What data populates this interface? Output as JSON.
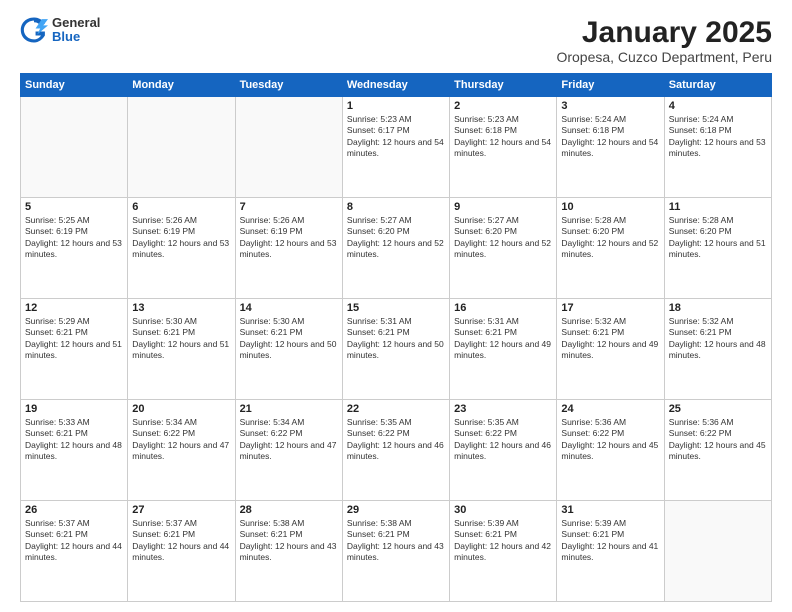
{
  "logo": {
    "general": "General",
    "blue": "Blue"
  },
  "title": "January 2025",
  "subtitle": "Oropesa, Cuzco Department, Peru",
  "days_of_week": [
    "Sunday",
    "Monday",
    "Tuesday",
    "Wednesday",
    "Thursday",
    "Friday",
    "Saturday"
  ],
  "cells": [
    {
      "day": "",
      "sunrise": "",
      "sunset": "",
      "daylight": ""
    },
    {
      "day": "",
      "sunrise": "",
      "sunset": "",
      "daylight": ""
    },
    {
      "day": "",
      "sunrise": "",
      "sunset": "",
      "daylight": ""
    },
    {
      "day": "1",
      "sunrise": "Sunrise: 5:23 AM",
      "sunset": "Sunset: 6:17 PM",
      "daylight": "Daylight: 12 hours and 54 minutes."
    },
    {
      "day": "2",
      "sunrise": "Sunrise: 5:23 AM",
      "sunset": "Sunset: 6:18 PM",
      "daylight": "Daylight: 12 hours and 54 minutes."
    },
    {
      "day": "3",
      "sunrise": "Sunrise: 5:24 AM",
      "sunset": "Sunset: 6:18 PM",
      "daylight": "Daylight: 12 hours and 54 minutes."
    },
    {
      "day": "4",
      "sunrise": "Sunrise: 5:24 AM",
      "sunset": "Sunset: 6:18 PM",
      "daylight": "Daylight: 12 hours and 53 minutes."
    },
    {
      "day": "5",
      "sunrise": "Sunrise: 5:25 AM",
      "sunset": "Sunset: 6:19 PM",
      "daylight": "Daylight: 12 hours and 53 minutes."
    },
    {
      "day": "6",
      "sunrise": "Sunrise: 5:26 AM",
      "sunset": "Sunset: 6:19 PM",
      "daylight": "Daylight: 12 hours and 53 minutes."
    },
    {
      "day": "7",
      "sunrise": "Sunrise: 5:26 AM",
      "sunset": "Sunset: 6:19 PM",
      "daylight": "Daylight: 12 hours and 53 minutes."
    },
    {
      "day": "8",
      "sunrise": "Sunrise: 5:27 AM",
      "sunset": "Sunset: 6:20 PM",
      "daylight": "Daylight: 12 hours and 52 minutes."
    },
    {
      "day": "9",
      "sunrise": "Sunrise: 5:27 AM",
      "sunset": "Sunset: 6:20 PM",
      "daylight": "Daylight: 12 hours and 52 minutes."
    },
    {
      "day": "10",
      "sunrise": "Sunrise: 5:28 AM",
      "sunset": "Sunset: 6:20 PM",
      "daylight": "Daylight: 12 hours and 52 minutes."
    },
    {
      "day": "11",
      "sunrise": "Sunrise: 5:28 AM",
      "sunset": "Sunset: 6:20 PM",
      "daylight": "Daylight: 12 hours and 51 minutes."
    },
    {
      "day": "12",
      "sunrise": "Sunrise: 5:29 AM",
      "sunset": "Sunset: 6:21 PM",
      "daylight": "Daylight: 12 hours and 51 minutes."
    },
    {
      "day": "13",
      "sunrise": "Sunrise: 5:30 AM",
      "sunset": "Sunset: 6:21 PM",
      "daylight": "Daylight: 12 hours and 51 minutes."
    },
    {
      "day": "14",
      "sunrise": "Sunrise: 5:30 AM",
      "sunset": "Sunset: 6:21 PM",
      "daylight": "Daylight: 12 hours and 50 minutes."
    },
    {
      "day": "15",
      "sunrise": "Sunrise: 5:31 AM",
      "sunset": "Sunset: 6:21 PM",
      "daylight": "Daylight: 12 hours and 50 minutes."
    },
    {
      "day": "16",
      "sunrise": "Sunrise: 5:31 AM",
      "sunset": "Sunset: 6:21 PM",
      "daylight": "Daylight: 12 hours and 49 minutes."
    },
    {
      "day": "17",
      "sunrise": "Sunrise: 5:32 AM",
      "sunset": "Sunset: 6:21 PM",
      "daylight": "Daylight: 12 hours and 49 minutes."
    },
    {
      "day": "18",
      "sunrise": "Sunrise: 5:32 AM",
      "sunset": "Sunset: 6:21 PM",
      "daylight": "Daylight: 12 hours and 48 minutes."
    },
    {
      "day": "19",
      "sunrise": "Sunrise: 5:33 AM",
      "sunset": "Sunset: 6:21 PM",
      "daylight": "Daylight: 12 hours and 48 minutes."
    },
    {
      "day": "20",
      "sunrise": "Sunrise: 5:34 AM",
      "sunset": "Sunset: 6:22 PM",
      "daylight": "Daylight: 12 hours and 47 minutes."
    },
    {
      "day": "21",
      "sunrise": "Sunrise: 5:34 AM",
      "sunset": "Sunset: 6:22 PM",
      "daylight": "Daylight: 12 hours and 47 minutes."
    },
    {
      "day": "22",
      "sunrise": "Sunrise: 5:35 AM",
      "sunset": "Sunset: 6:22 PM",
      "daylight": "Daylight: 12 hours and 46 minutes."
    },
    {
      "day": "23",
      "sunrise": "Sunrise: 5:35 AM",
      "sunset": "Sunset: 6:22 PM",
      "daylight": "Daylight: 12 hours and 46 minutes."
    },
    {
      "day": "24",
      "sunrise": "Sunrise: 5:36 AM",
      "sunset": "Sunset: 6:22 PM",
      "daylight": "Daylight: 12 hours and 45 minutes."
    },
    {
      "day": "25",
      "sunrise": "Sunrise: 5:36 AM",
      "sunset": "Sunset: 6:22 PM",
      "daylight": "Daylight: 12 hours and 45 minutes."
    },
    {
      "day": "26",
      "sunrise": "Sunrise: 5:37 AM",
      "sunset": "Sunset: 6:21 PM",
      "daylight": "Daylight: 12 hours and 44 minutes."
    },
    {
      "day": "27",
      "sunrise": "Sunrise: 5:37 AM",
      "sunset": "Sunset: 6:21 PM",
      "daylight": "Daylight: 12 hours and 44 minutes."
    },
    {
      "day": "28",
      "sunrise": "Sunrise: 5:38 AM",
      "sunset": "Sunset: 6:21 PM",
      "daylight": "Daylight: 12 hours and 43 minutes."
    },
    {
      "day": "29",
      "sunrise": "Sunrise: 5:38 AM",
      "sunset": "Sunset: 6:21 PM",
      "daylight": "Daylight: 12 hours and 43 minutes."
    },
    {
      "day": "30",
      "sunrise": "Sunrise: 5:39 AM",
      "sunset": "Sunset: 6:21 PM",
      "daylight": "Daylight: 12 hours and 42 minutes."
    },
    {
      "day": "31",
      "sunrise": "Sunrise: 5:39 AM",
      "sunset": "Sunset: 6:21 PM",
      "daylight": "Daylight: 12 hours and 41 minutes."
    },
    {
      "day": "",
      "sunrise": "",
      "sunset": "",
      "daylight": ""
    }
  ]
}
